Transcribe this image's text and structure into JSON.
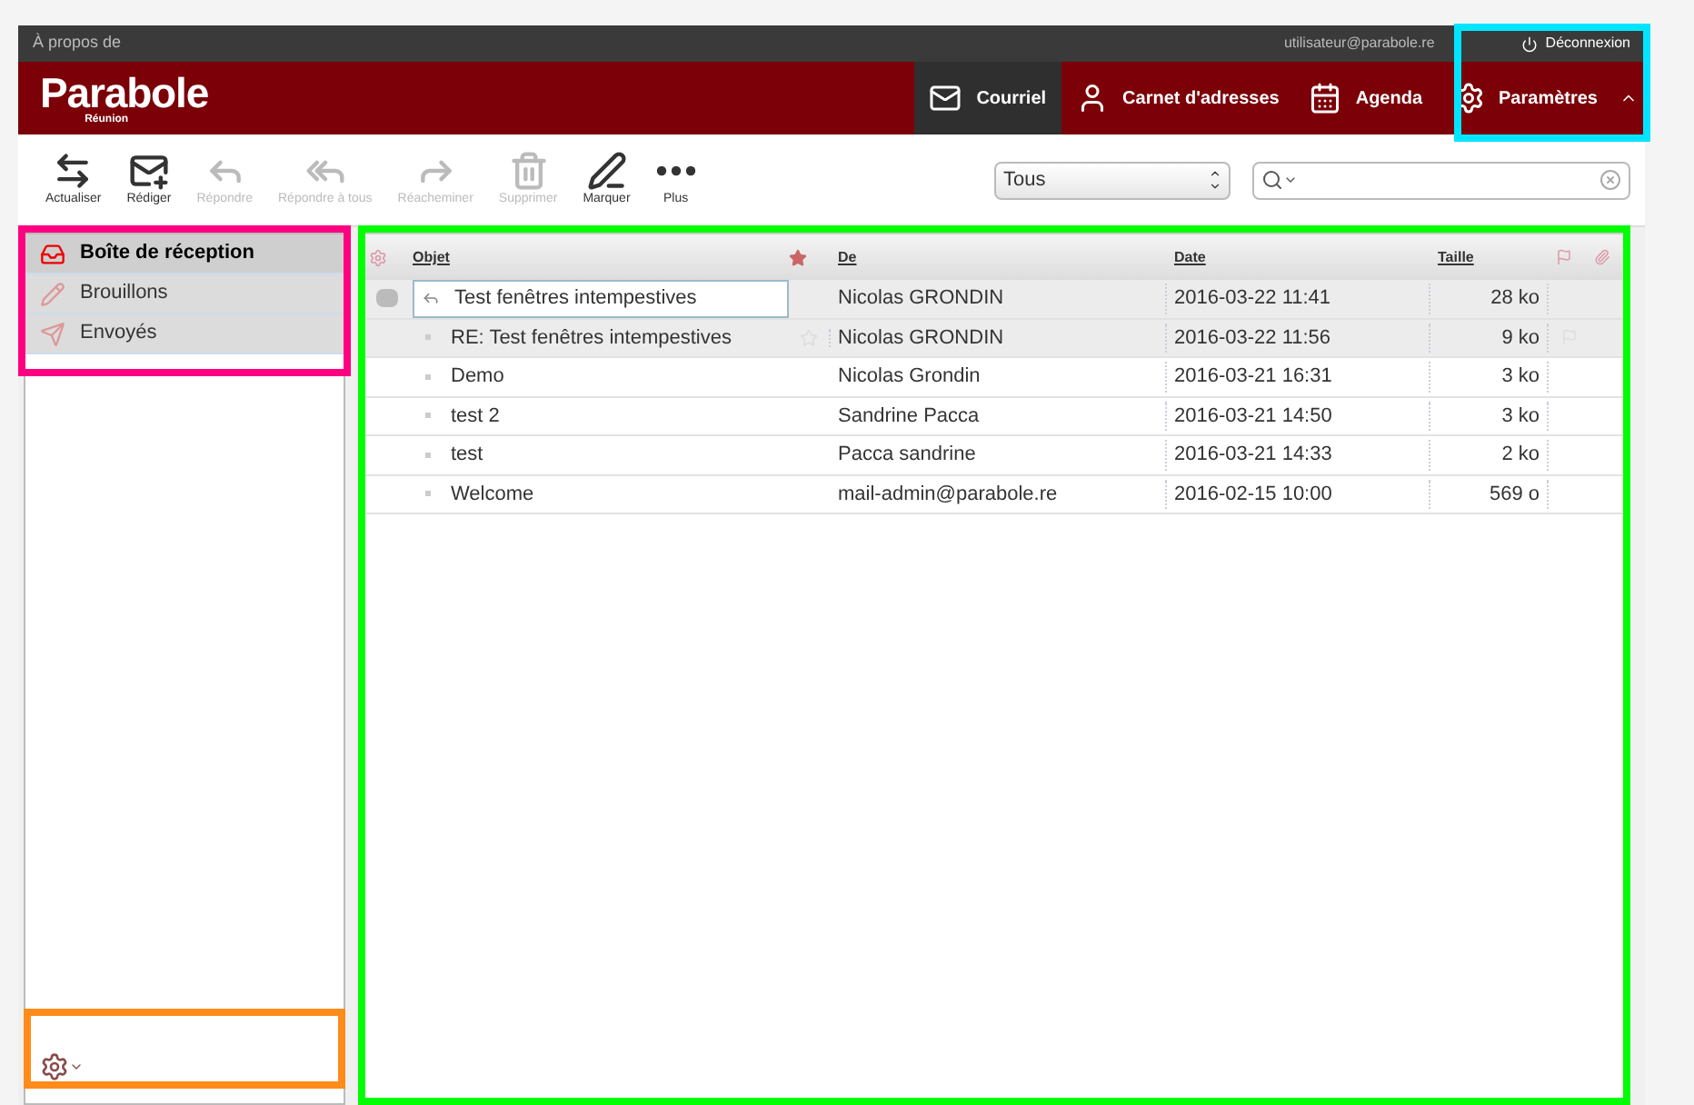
{
  "topbar": {
    "about": "À propos de",
    "user": "utilisateur@parabole.re",
    "logout": "Déconnexion"
  },
  "header": {
    "logo": "Parabole",
    "logo_sub": "Réunion",
    "nav": [
      {
        "kind": "mail",
        "label": "Courriel",
        "selected": true
      },
      {
        "kind": "contacts",
        "label": "Carnet d'adresses",
        "selected": false
      },
      {
        "kind": "calendar",
        "label": "Agenda",
        "selected": false
      },
      {
        "kind": "settings",
        "label": "Paramètres",
        "selected": false
      }
    ]
  },
  "toolbar": [
    {
      "kind": "refresh",
      "label": "Actualiser",
      "disabled": false
    },
    {
      "kind": "compose",
      "label": "Rédiger",
      "disabled": false
    },
    {
      "kind": "reply",
      "label": "Répondre",
      "disabled": true
    },
    {
      "kind": "replyall",
      "label": "Répondre à tous",
      "disabled": true
    },
    {
      "kind": "forward",
      "label": "Réacheminer",
      "disabled": true
    },
    {
      "kind": "delete",
      "label": "Supprimer",
      "disabled": true
    },
    {
      "kind": "mark",
      "label": "Marquer",
      "disabled": false
    },
    {
      "kind": "more",
      "label": "Plus",
      "disabled": false
    }
  ],
  "filter": {
    "value": "Tous"
  },
  "folders": [
    {
      "kind": "inbox",
      "label": "Boîte de réception",
      "selected": true
    },
    {
      "kind": "drafts",
      "label": "Brouillons",
      "selected": false
    },
    {
      "kind": "sent",
      "label": "Envoyés",
      "selected": false
    }
  ],
  "table": {
    "columns": [
      "Objet",
      "De",
      "Date",
      "Taille"
    ],
    "rows": [
      {
        "subject": "Test fenêtres intempestives",
        "from": "Nicolas GRONDIN",
        "date": "2016-03-22 11:41",
        "size": "28 ko",
        "selected": true,
        "focused": true,
        "replied": true,
        "hover": false
      },
      {
        "subject": "RE: Test fenêtres intempestives",
        "from": "Nicolas GRONDIN",
        "date": "2016-03-22 11:56",
        "size": "9 ko",
        "selected": true,
        "focused": false,
        "replied": false,
        "hover": true
      },
      {
        "subject": "Demo",
        "from": "Nicolas Grondin",
        "date": "2016-03-21 16:31",
        "size": "3 ko",
        "selected": false,
        "focused": false,
        "replied": false,
        "hover": false
      },
      {
        "subject": "test 2",
        "from": "Sandrine Pacca",
        "date": "2016-03-21 14:50",
        "size": "3 ko",
        "selected": false,
        "focused": false,
        "replied": false,
        "hover": false
      },
      {
        "subject": "test",
        "from": "Pacca sandrine",
        "date": "2016-03-21 14:33",
        "size": "2 ko",
        "selected": false,
        "focused": false,
        "replied": false,
        "hover": false
      },
      {
        "subject": "Welcome",
        "from": "mail-admin@parabole.re",
        "date": "2016-02-15 10:00",
        "size": "569 o",
        "selected": false,
        "focused": false,
        "replied": false,
        "hover": false
      }
    ]
  },
  "highlights": [
    {
      "kind": "folders",
      "color": "#ff0080"
    },
    {
      "kind": "list",
      "color": "#00ff00"
    },
    {
      "kind": "settings",
      "color": "#00e5ff"
    },
    {
      "kind": "footer",
      "color": "#ff8c1a"
    }
  ]
}
